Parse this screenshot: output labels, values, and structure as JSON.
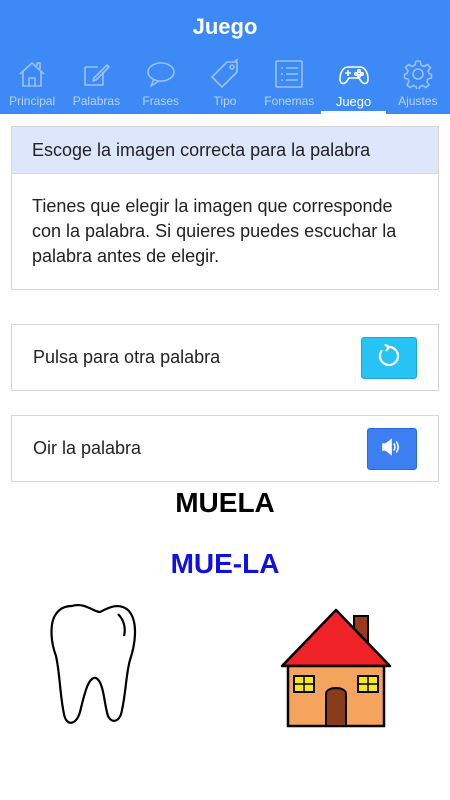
{
  "app": {
    "title": "Juego"
  },
  "tabs": [
    {
      "label": "Principal",
      "icon": "home-icon"
    },
    {
      "label": "Palabras",
      "icon": "edit-icon"
    },
    {
      "label": "Frases",
      "icon": "chat-icon"
    },
    {
      "label": "Tipo",
      "icon": "tag-icon"
    },
    {
      "label": "Fonemas",
      "icon": "list-icon"
    },
    {
      "label": "Juego",
      "icon": "gamepad-icon",
      "active": true
    },
    {
      "label": "Ajustes",
      "icon": "gear-icon"
    }
  ],
  "instructions": {
    "title": "Escoge la imagen correcta para la palabra",
    "body": "Tienes que elegir la imagen que corresponde con la palabra. Si quieres puedes escuchar la palabra antes de elegir."
  },
  "actions": {
    "new_word_label": "Pulsa para otra palabra",
    "new_word_icon": "refresh-icon",
    "listen_label": "Oir la palabra",
    "listen_icon": "speaker-icon"
  },
  "word": {
    "text": "MUELA",
    "syllables": "MUE-LA"
  },
  "options": [
    {
      "icon": "tooth-image"
    },
    {
      "icon": "house-image"
    }
  ],
  "colors": {
    "primary": "#3d8af7",
    "header_bg": "#dde6fa",
    "refresh_button": "#26c3f4",
    "audio_button": "#3b7ff2",
    "syllables_text": "#1010e0"
  }
}
